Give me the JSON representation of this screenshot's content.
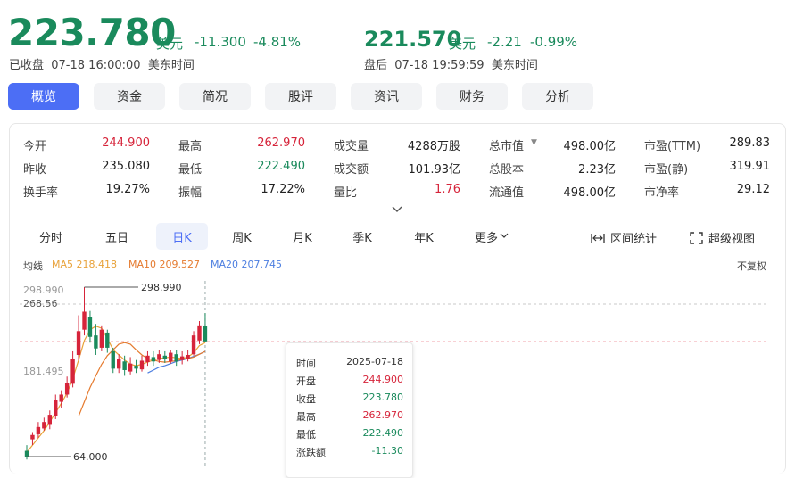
{
  "header": {
    "price": "223.780",
    "currency": "美元",
    "change": "-11.300",
    "change_pct": "-4.81%",
    "status": "已收盘  07-18 16:00:00  美东时间",
    "after_price": "221.570",
    "after_currency": "美元",
    "after_change": "-2.21",
    "after_change_pct": "-0.99%",
    "after_status": "盘后  07-18 19:59:59  美东时间"
  },
  "tabs": [
    "概览",
    "资金",
    "简况",
    "股评",
    "资讯",
    "财务",
    "分析"
  ],
  "stats": [
    [
      {
        "label": "今开",
        "value": "244.900",
        "color": "red"
      },
      {
        "label": "最高",
        "value": "262.970",
        "color": "red"
      },
      {
        "label": "成交量",
        "value": "4288万股",
        "color": "normal"
      },
      {
        "label": "总市值",
        "value": "498.00亿",
        "color": "normal",
        "icon": "triangle-down-icon"
      },
      {
        "label": "市盈(TTM)",
        "value": "289.83",
        "color": "normal"
      }
    ],
    [
      {
        "label": "昨收",
        "value": "235.080",
        "color": "normal"
      },
      {
        "label": "最低",
        "value": "222.490",
        "color": "green"
      },
      {
        "label": "成交额",
        "value": "101.93亿",
        "color": "normal"
      },
      {
        "label": "总股本",
        "value": "2.23亿",
        "color": "normal"
      },
      {
        "label": "市盈(静)",
        "value": "319.91",
        "color": "normal"
      }
    ],
    [
      {
        "label": "换手率",
        "value": "19.27%",
        "color": "normal"
      },
      {
        "label": "振幅",
        "value": "17.22%",
        "color": "normal"
      },
      {
        "label": "量比",
        "value": "1.76",
        "color": "red"
      },
      {
        "label": "流通值",
        "value": "498.00亿",
        "color": "normal"
      },
      {
        "label": "市净率",
        "value": "29.12",
        "color": "normal"
      }
    ]
  ],
  "chart_tabs": [
    "分时",
    "五日",
    "日K",
    "周K",
    "月K",
    "季K",
    "年K",
    "更多"
  ],
  "chart_tools": {
    "range_stats": "区间统计",
    "super_view": "超级视图",
    "no_adjust": "不复权"
  },
  "ma": {
    "label": "均线",
    "ma5": "MA5 218.418",
    "ma10": "MA10 209.527",
    "ma20": "MA20 207.745"
  },
  "colors": {
    "up": "#d6243a",
    "down": "#1a8a5c",
    "accent": "#4c6ef5",
    "ma5": "#e8a23a",
    "ma10": "#e57a2e",
    "ma20": "#4c7ee0"
  },
  "chart_data": {
    "type": "candlestick",
    "y_ticks": [
      "298.990",
      "268.56",
      "181.495"
    ],
    "y_min_label": "64.000",
    "max_marker": "298.990",
    "min_marker": "64.000",
    "ylim": [
      40,
      310
    ],
    "candles": [
      {
        "o": 72,
        "c": 64,
        "h": 80,
        "l": 60
      },
      {
        "o": 88,
        "c": 94,
        "h": 98,
        "l": 80
      },
      {
        "o": 95,
        "c": 105,
        "h": 112,
        "l": 90
      },
      {
        "o": 103,
        "c": 112,
        "h": 118,
        "l": 100
      },
      {
        "o": 108,
        "c": 122,
        "h": 128,
        "l": 102
      },
      {
        "o": 120,
        "c": 142,
        "h": 150,
        "l": 116
      },
      {
        "o": 140,
        "c": 150,
        "h": 156,
        "l": 132
      },
      {
        "o": 150,
        "c": 166,
        "h": 175,
        "l": 146
      },
      {
        "o": 165,
        "c": 200,
        "h": 210,
        "l": 160
      },
      {
        "o": 205,
        "c": 238,
        "h": 260,
        "l": 198
      },
      {
        "o": 240,
        "c": 265,
        "h": 298.99,
        "l": 232
      },
      {
        "o": 258,
        "c": 230,
        "h": 266,
        "l": 222
      },
      {
        "o": 232,
        "c": 214,
        "h": 248,
        "l": 205
      },
      {
        "o": 215,
        "c": 240,
        "h": 246,
        "l": 210
      },
      {
        "o": 236,
        "c": 215,
        "h": 240,
        "l": 208
      },
      {
        "o": 210,
        "c": 186,
        "h": 215,
        "l": 180
      },
      {
        "o": 186,
        "c": 200,
        "h": 206,
        "l": 180
      },
      {
        "o": 196,
        "c": 184,
        "h": 204,
        "l": 176
      },
      {
        "o": 182,
        "c": 193,
        "h": 202,
        "l": 178
      },
      {
        "o": 190,
        "c": 186,
        "h": 198,
        "l": 180
      },
      {
        "o": 185,
        "c": 197,
        "h": 204,
        "l": 182
      },
      {
        "o": 195,
        "c": 204,
        "h": 210,
        "l": 190
      },
      {
        "o": 202,
        "c": 196,
        "h": 210,
        "l": 190
      },
      {
        "o": 198,
        "c": 206,
        "h": 212,
        "l": 194
      },
      {
        "o": 204,
        "c": 200,
        "h": 210,
        "l": 194
      },
      {
        "o": 196,
        "c": 208,
        "h": 212,
        "l": 193
      },
      {
        "o": 206,
        "c": 196,
        "h": 212,
        "l": 190
      },
      {
        "o": 198,
        "c": 203,
        "h": 210,
        "l": 192
      },
      {
        "o": 200,
        "c": 205,
        "h": 212,
        "l": 196
      },
      {
        "o": 206,
        "c": 232,
        "h": 238,
        "l": 204
      },
      {
        "o": 225,
        "c": 246,
        "h": 252,
        "l": 220
      },
      {
        "o": 244.9,
        "c": 223.78,
        "h": 262.97,
        "l": 222.49
      }
    ],
    "ma5": [
      70,
      80,
      90,
      100,
      112,
      125,
      138,
      152,
      172,
      198,
      225,
      240,
      245,
      242,
      228,
      212,
      205,
      198,
      192,
      190,
      192,
      195,
      198,
      200,
      201,
      202,
      201,
      200,
      202,
      208,
      218,
      222
    ],
    "ma10": [
      null,
      null,
      null,
      null,
      null,
      null,
      null,
      null,
      null,
      120,
      140,
      160,
      176,
      192,
      204,
      212,
      220,
      222,
      220,
      212,
      205,
      200,
      198,
      196,
      195,
      196,
      197,
      199,
      200,
      202,
      206,
      210
    ],
    "ma20": [
      null,
      null,
      null,
      null,
      null,
      null,
      null,
      null,
      null,
      null,
      null,
      null,
      null,
      null,
      null,
      null,
      null,
      null,
      null,
      null,
      null,
      180,
      184,
      188,
      190,
      193,
      196,
      198,
      200,
      203,
      206,
      210
    ],
    "tooltip": {
      "rows": [
        {
          "k": "时间",
          "v": "2025-07-18",
          "c": "normal"
        },
        {
          "k": "开盘",
          "v": "244.900",
          "c": "red"
        },
        {
          "k": "收盘",
          "v": "223.780",
          "c": "green"
        },
        {
          "k": "最高",
          "v": "262.970",
          "c": "red"
        },
        {
          "k": "最低",
          "v": "222.490",
          "c": "green"
        },
        {
          "k": "涨跌额",
          "v": "-11.30",
          "c": "green"
        }
      ]
    }
  }
}
